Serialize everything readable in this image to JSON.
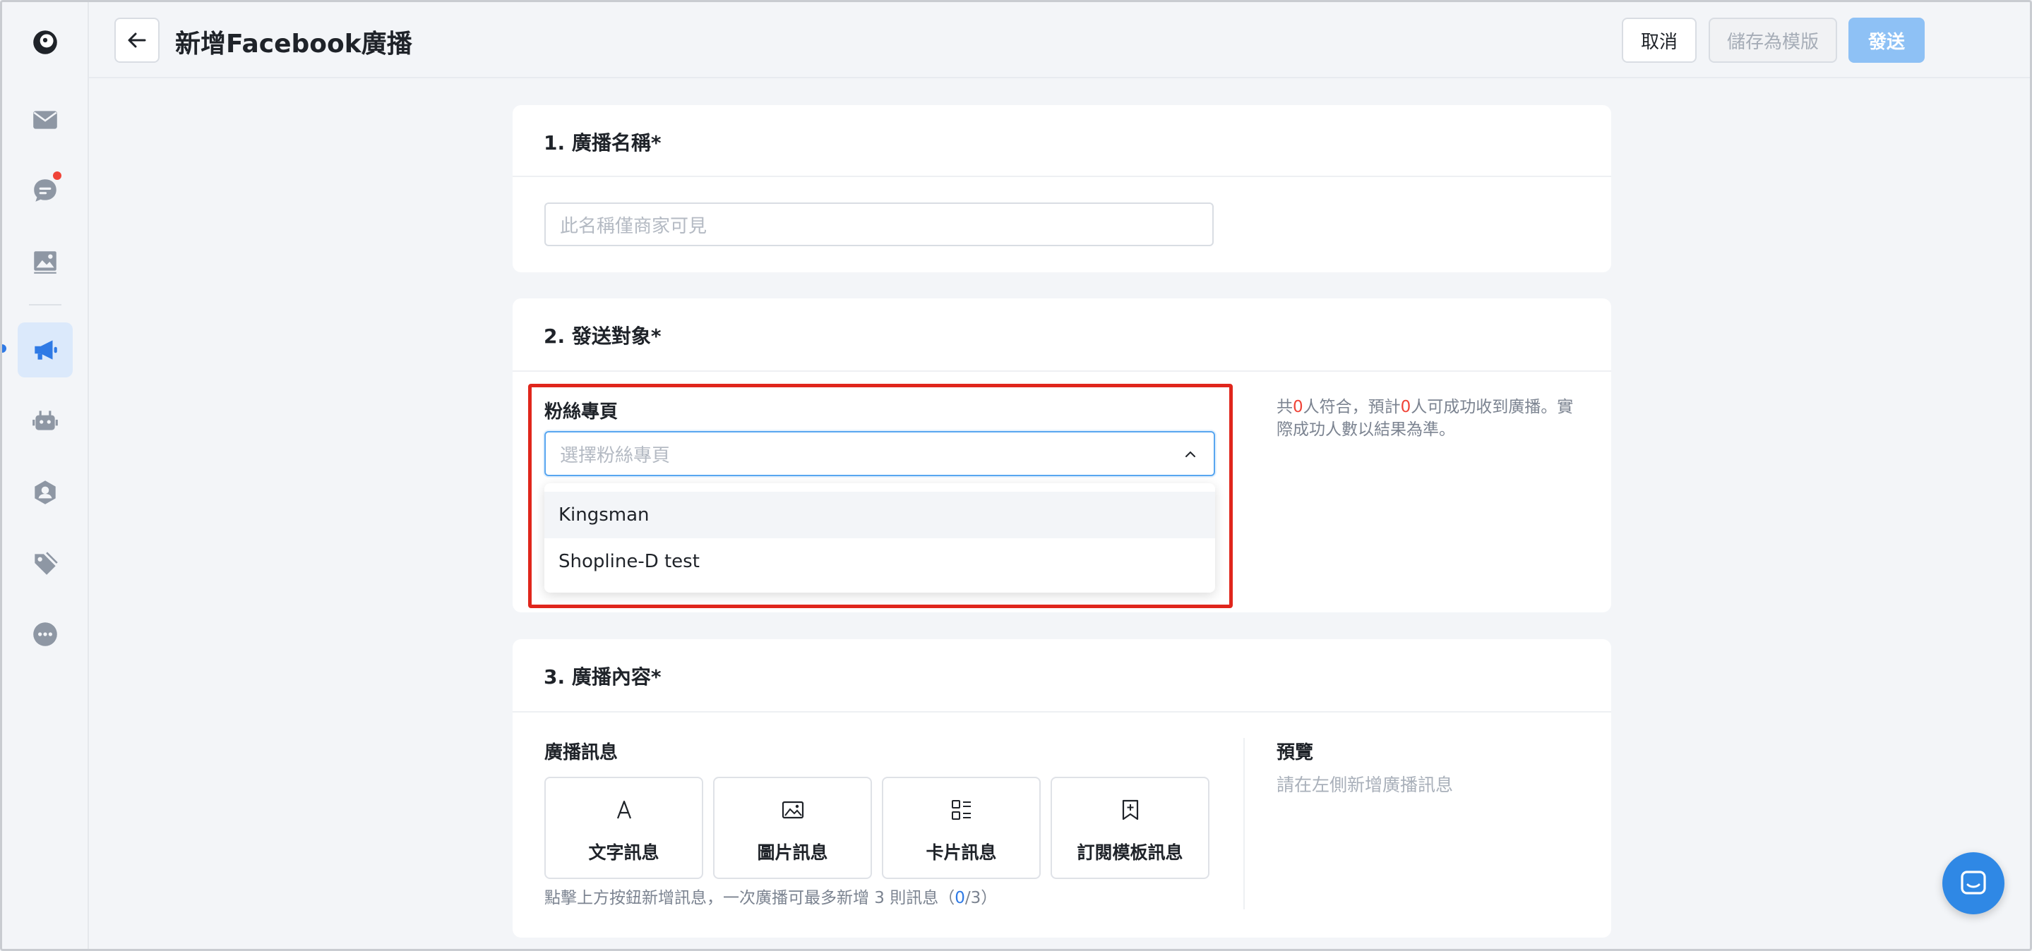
{
  "header": {
    "title": "新增Facebook廣播",
    "cancel_label": "取消",
    "save_template_label": "儲存為模版",
    "send_label": "發送"
  },
  "sidebar": {
    "items": [
      {
        "icon": "logo-icon"
      },
      {
        "icon": "inbox-icon"
      },
      {
        "icon": "chat-icon",
        "badge": true
      },
      {
        "icon": "image-icon"
      },
      {
        "icon": "megaphone-icon",
        "active": true
      },
      {
        "icon": "robot-icon"
      },
      {
        "icon": "contacts-icon"
      },
      {
        "icon": "tag-icon"
      },
      {
        "icon": "more-icon"
      }
    ]
  },
  "section1": {
    "title": "1. 廣播名稱*",
    "name_placeholder": "此名稱僅商家可見"
  },
  "section2": {
    "title": "2. 發送對象*",
    "fanpage_label": "粉絲專頁",
    "fanpage_placeholder": "選擇粉絲專頁",
    "options": [
      "Kingsman",
      "Shopline-D test"
    ],
    "summary_prefix": "共",
    "matched_count": "0",
    "summary_mid": "人符合，預計",
    "reach_count": "0",
    "summary_suffix": "人可成功收到廣播。實際成功人數以結果為準。"
  },
  "section3": {
    "title": "3. 廣播內容*",
    "messages_label": "廣播訊息",
    "buttons": [
      {
        "label": "文字訊息",
        "icon": "text-icon"
      },
      {
        "label": "圖片訊息",
        "icon": "image-icon"
      },
      {
        "label": "卡片訊息",
        "icon": "card-list-icon"
      },
      {
        "label": "訂閱模板訊息",
        "icon": "bookmark-add-icon"
      }
    ],
    "hint_prefix": "點擊上方按鈕新增訊息，一次廣播可最多新增 3 則訊息（",
    "hint_count": "0",
    "hint_suffix": "/3）",
    "preview_label": "預覽",
    "preview_empty": "請在左側新增廣播訊息"
  },
  "colors": {
    "accent": "#2f7ae5",
    "send_button": "#8ec1f5",
    "alert_red": "#f04438",
    "highlight": "#e0261c"
  }
}
